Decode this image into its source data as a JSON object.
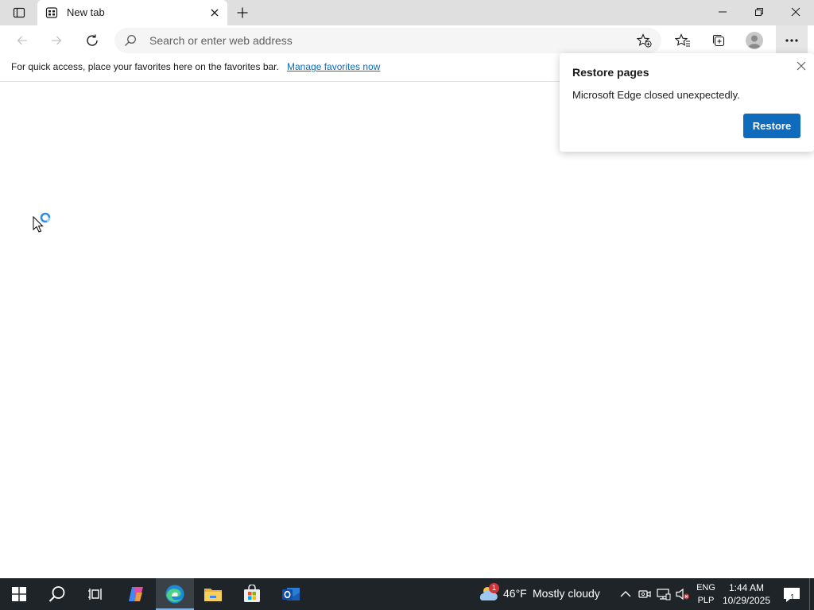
{
  "browser": {
    "tab": {
      "title": "New tab"
    },
    "address_bar": {
      "placeholder": "Search or enter web address",
      "value": ""
    },
    "favorites_bar": {
      "text": "For quick access, place your favorites here on the favorites bar.",
      "link": "Manage favorites now"
    }
  },
  "restore_popup": {
    "title": "Restore pages",
    "message": "Microsoft Edge closed unexpectedly.",
    "button": "Restore"
  },
  "taskbar": {
    "weather": {
      "badge": "1",
      "temperature": "46°F",
      "condition": "Mostly cloudy"
    },
    "language": {
      "line1": "ENG",
      "line2": "PLP"
    },
    "clock": {
      "time": "1:44 AM",
      "date": "10/29/2025"
    },
    "notifications": {
      "count": "1"
    }
  },
  "colors": {
    "accent": "#0f6cbd",
    "taskbar": "#1e2428",
    "tabstrip": "#dfdfdf"
  },
  "icons": {
    "tab_actions": "tab-actions-icon",
    "favicon": "new-tab-page-icon",
    "close": "close-icon",
    "new_tab": "plus-icon",
    "back": "arrow-left-icon",
    "forward": "arrow-right-icon",
    "refresh": "refresh-icon",
    "search": "search-icon",
    "add_favorite": "star-plus-icon",
    "favorites": "favorites-icon",
    "collections": "collections-icon",
    "profile": "profile-icon",
    "more": "more-dots-icon"
  }
}
